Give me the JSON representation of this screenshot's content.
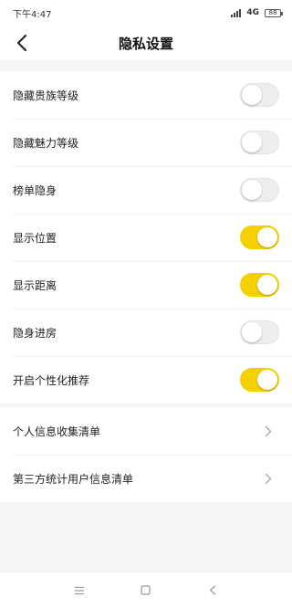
{
  "status_bar": {
    "time": "下午4:47",
    "network": "4G",
    "battery": "88"
  },
  "header": {
    "title": "隐私设置"
  },
  "settings": [
    {
      "label": "隐藏贵族等级",
      "enabled": false
    },
    {
      "label": "隐藏魅力等级",
      "enabled": false
    },
    {
      "label": "榜单隐身",
      "enabled": false
    },
    {
      "label": "显示位置",
      "enabled": true
    },
    {
      "label": "显示距离",
      "enabled": true
    },
    {
      "label": "隐身进房",
      "enabled": false
    },
    {
      "label": "开启个性化推荐",
      "enabled": true
    }
  ],
  "links": [
    {
      "label": "个人信息收集清单"
    },
    {
      "label": "第三方统计用户信息清单"
    }
  ],
  "colors": {
    "toggle_on": "#f5d000",
    "toggle_off": "#eeeeee"
  }
}
